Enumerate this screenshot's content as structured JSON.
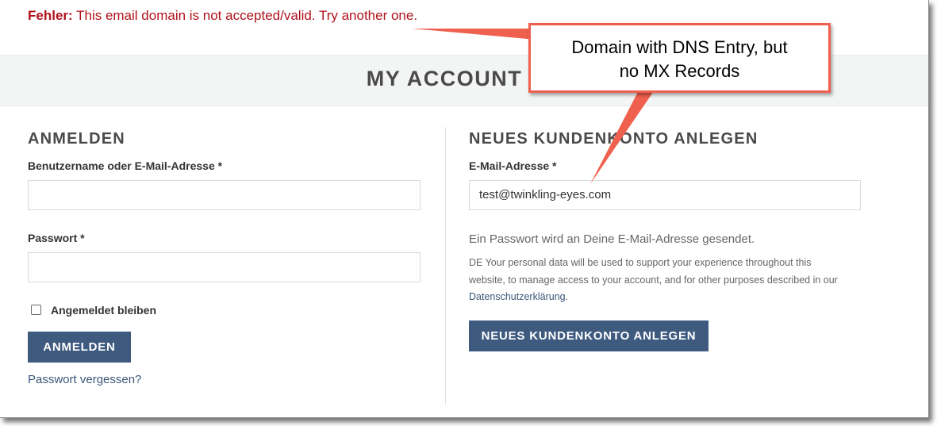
{
  "error": {
    "label": "Fehler:",
    "message": " This email domain is not accepted/valid. Try another one."
  },
  "page": {
    "title": "MY ACCOUNT"
  },
  "login": {
    "heading": "ANMELDEN",
    "username_label": "Benutzername oder E-Mail-Adresse *",
    "username_value": "",
    "password_label": "Passwort *",
    "password_value": "",
    "remember_label": "Angemeldet bleiben",
    "remember_checked": false,
    "submit_label": "ANMELDEN",
    "forgot_link": "Passwort vergessen?"
  },
  "register": {
    "heading": "NEUES KUNDENKONTO ANLEGEN",
    "email_label": "E-Mail-Adresse *",
    "email_value": "test@twinkling-eyes.com",
    "password_info": "Ein Passwort wird an Deine E-Mail-Adresse gesendet.",
    "privacy_text": "DE Your personal data will be used to support your experience throughout this website, to manage access to your account, and for other purposes described in our ",
    "privacy_link": "Datenschutzerklärung",
    "privacy_end": ".",
    "submit_label": "NEUES KUNDENKONTO ANLEGEN"
  },
  "annotation": {
    "line1": "Domain with DNS Entry, but",
    "line2": "no MX Records",
    "color": "#f0604e"
  },
  "colors": {
    "error": "#b0121b",
    "button": "#3e5a7f",
    "link": "#3b5779",
    "title_band": "#f3f5f4"
  }
}
